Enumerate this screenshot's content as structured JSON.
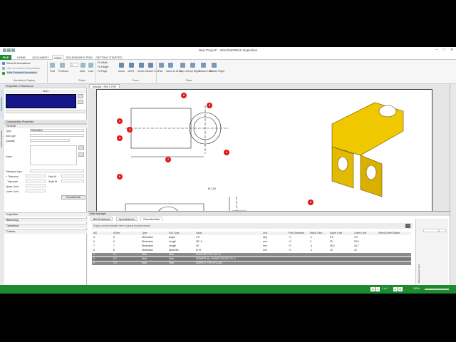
{
  "window": {
    "title": "New Project* - SOLIDWORKS Inspection",
    "min": "–",
    "max": "□",
    "close": "✕"
  },
  "tabs": [
    "FILE",
    "HOME",
    "DOCUMENT",
    "VIEW",
    "SOLIDWORKS PDM",
    "GETTING STARTED"
  ],
  "ribbon": {
    "annotation": {
      "items": [
        "Show All Annotations",
        "Hide Un-selected Annotations",
        "Hide Extracted Annotation"
      ],
      "label": "Annotation Display"
    },
    "sheet": {
      "first": "First",
      "previous": "Previous",
      "page": "1",
      "next": "Next",
      "last": "Last",
      "label": "Sheet"
    },
    "zoom": {
      "fit_width": "Fit Width",
      "fit_height": "Fit Height",
      "fit_page": "Fit Page",
      "buttons": [
        "Zoom",
        "100%",
        "Zoom In",
        "Zoom Out"
      ],
      "label": "Zoom"
    },
    "show": {
      "buttons": [
        "Pan",
        "Zoom to Area",
        "Top Left",
        "Top Right",
        "Bottom Left",
        "Bottom Right"
      ],
      "label": "Show"
    }
  },
  "left_panel": {
    "header": "Properties / Preferences",
    "vtabs": [
      "Characteristics",
      "Project Properties"
    ],
    "counter": "11/11",
    "section_title": "Characteristic Properties",
    "general": "General",
    "fields": {
      "type": "Type",
      "type_value": "Dimension",
      "subtype": "Sub-type",
      "quantity": "Quantity",
      "value": "Value",
      "tolerance_type": "Tolerance type",
      "plus_tol": "+ Tolerance",
      "minus_tol": "- Tolerance",
      "hole_fit": "Hole fit",
      "shaft_fit": "Shaft fit",
      "upper_limit": "Upper Limit",
      "lower_limit": "Lower Limit",
      "char_button": "Characteristic"
    },
    "sections": [
      "Inspection",
      "Ballooning",
      "Operations",
      "Custom"
    ]
  },
  "drawing": {
    "doc_tab": "Knuckle - Rev C.PDF",
    "balloons": [
      "1",
      "2",
      "3",
      "4",
      "5",
      "6",
      "7",
      "8",
      "9"
    ],
    "dims": [
      "Ø.120",
      "1.5 x 45.0°",
      "C",
      "A",
      "Ø.120±.5",
      "122.0"
    ]
  },
  "table_manager": {
    "title": "Table Manager",
    "tabs": [
      "Bill Of Material",
      "Specifications",
      "Characteristics"
    ],
    "group_hint": "Drag a column header here to group by that column",
    "columns": [
      "#ID",
      "#Char",
      "Type",
      "Sub-Type",
      "Value",
      "Unit",
      "Plus Tolerance",
      "Minus Toler...",
      "Upper Limit",
      "Lower Limit",
      "Sheet/Zone/Gridline"
    ],
    "rows": [
      [
        "5",
        "5",
        "Dimension",
        "Angle",
        "4.9",
        "deg",
        "+1",
        "-1",
        "5.9",
        "3.9",
        ""
      ],
      [
        "6",
        "6",
        "Dimension",
        "Length",
        "28 +1",
        "mm",
        "+1",
        "0",
        "29",
        "28.5",
        ""
      ],
      [
        "7",
        "7",
        "Dimension",
        "Length",
        "45",
        "mm",
        "+1",
        "-0",
        "45.3",
        "44.7",
        ""
      ],
      [
        "8",
        "8",
        "Dimension",
        "Diameter",
        "Ø 19",
        "mm",
        "+1",
        "-1",
        "19",
        "19",
        ""
      ],
      [
        "9",
        "9.1",
        "Note",
        "Note",
        "ANODIZE PER XYZ-10",
        "",
        "",
        "",
        "",
        "",
        ""
      ],
      [
        "9",
        "9.2",
        "Note",
        "Note",
        "DEBURR ALL SHARP EDGES TO .5",
        "",
        "",
        "",
        "",
        "",
        ""
      ],
      [
        "9",
        "9.3",
        "Note",
        "Note",
        "INSPECT PER XYZ-250",
        "",
        "",
        "",
        "",
        "",
        ""
      ]
    ],
    "side_label": "Measurement Input",
    "side_value": "1"
  },
  "status": {
    "pages": "1 of 1",
    "zoom": "100%"
  },
  "colors": {
    "accent": "#1e8a2e",
    "balloon": "#e01818",
    "part": "#f0c800"
  }
}
